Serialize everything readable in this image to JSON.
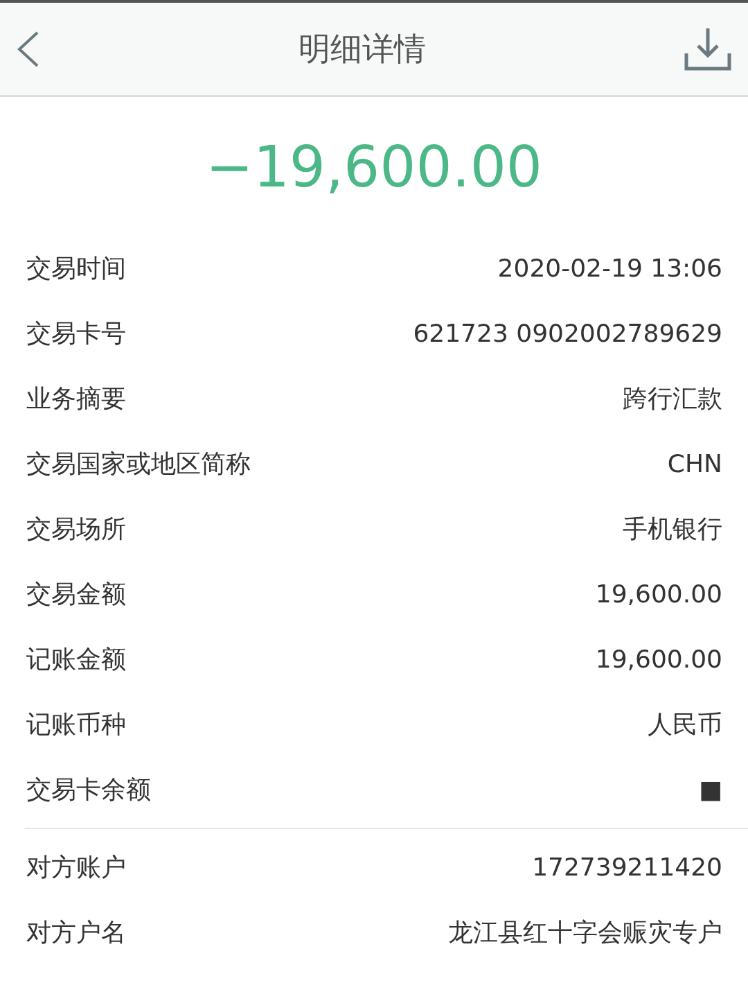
{
  "header": {
    "title": "明细详情"
  },
  "amount": "−19,600.00",
  "details": [
    {
      "label": "交易时间",
      "value": "2020-02-19 13:06"
    },
    {
      "label": "交易卡号",
      "value": "621723 0902002789629"
    },
    {
      "label": "业务摘要",
      "value": "跨行汇款"
    },
    {
      "label": "交易国家或地区简称",
      "value": "CHN"
    },
    {
      "label": "交易场所",
      "value": "手机银行"
    },
    {
      "label": "交易金额",
      "value": "19,600.00"
    },
    {
      "label": "记账金额",
      "value": "19,600.00"
    },
    {
      "label": "记账币种",
      "value": "人民币"
    },
    {
      "label": "交易卡余额",
      "value": "■"
    }
  ],
  "counterparty": [
    {
      "label": "对方账户",
      "value": "172739211420"
    },
    {
      "label": "对方户名",
      "value": "龙江县红十字会赈灾专户"
    }
  ]
}
